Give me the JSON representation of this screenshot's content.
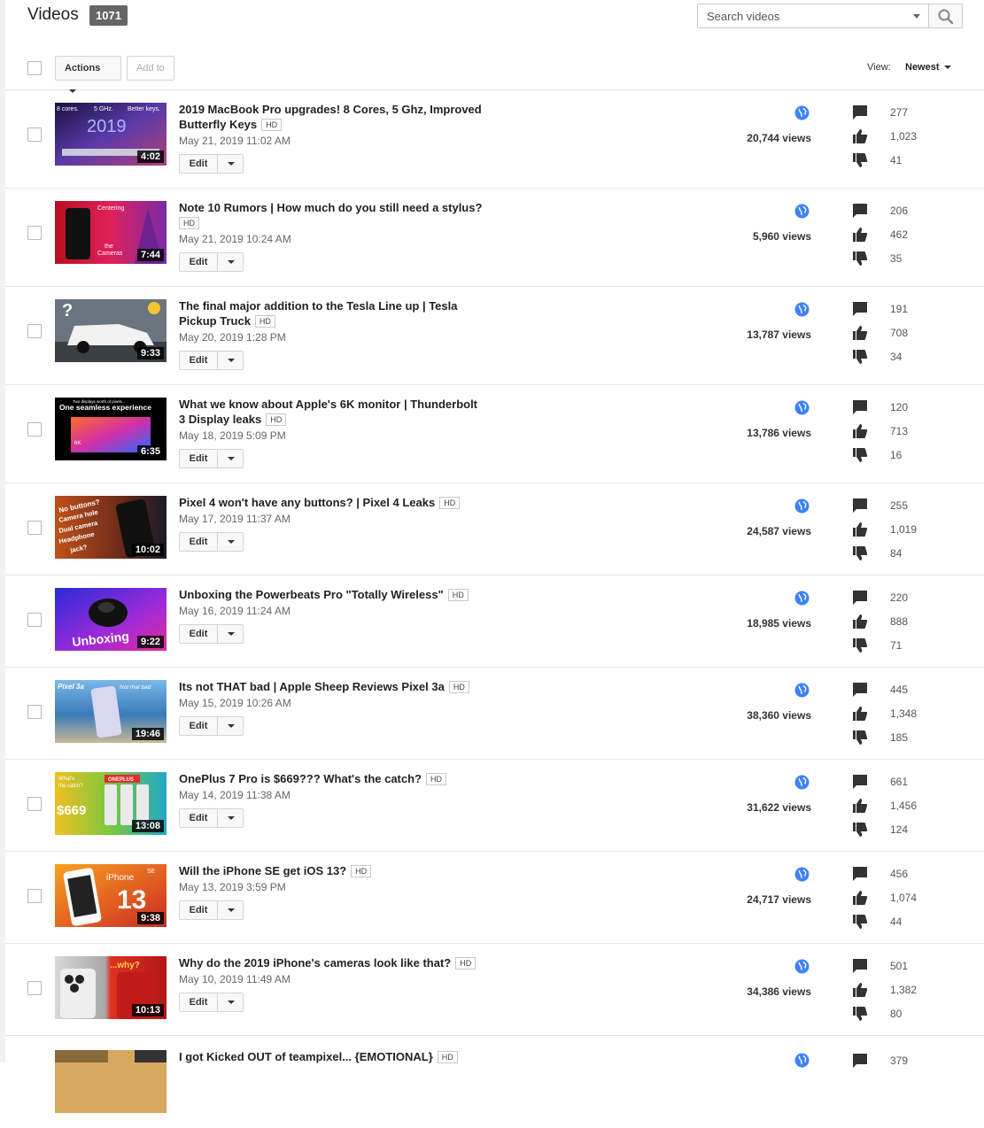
{
  "header": {
    "title": "Videos",
    "count": "1071",
    "search_placeholder": "Search videos"
  },
  "toolbar": {
    "actions_label": "Actions",
    "add_to_label": "Add to",
    "view_label": "View:",
    "sort_value": "Newest"
  },
  "icons": {
    "search": "search-icon",
    "globe": "globe-icon",
    "comments": "comment-icon",
    "likes": "thumbs-up-icon",
    "dislikes": "thumbs-down-icon"
  },
  "colors": {
    "globe": "#3e82f7",
    "badge": "#666666",
    "stat_icon": "#333333"
  },
  "videos": [
    {
      "title": "2019 MacBook Pro upgrades! 8 Cores, 5 Ghz, Improved Butterfly Keys",
      "hd": "HD",
      "date": "May 21, 2019 11:02 AM",
      "duration": "4:02",
      "views": "20,744 views",
      "comments": "277",
      "likes": "1,023",
      "dislikes": "41",
      "edit_label": "Edit",
      "thumb_text": [
        "8 cores.",
        "5 GHz.",
        "Better keys.",
        "2019"
      ]
    },
    {
      "title": "Note 10 Rumors | How much do you still need a stylus?",
      "hd": "HD",
      "date": "May 21, 2019 10:24 AM",
      "duration": "7:44",
      "views": "5,960 views",
      "comments": "206",
      "likes": "462",
      "dislikes": "35",
      "edit_label": "Edit",
      "thumb_text": [
        "Centering",
        "the",
        "Cameras"
      ]
    },
    {
      "title": "The final major addition to the Tesla Line up | Tesla Pickup Truck",
      "hd": "HD",
      "date": "May 20, 2019 1:28 PM",
      "duration": "9:33",
      "views": "13,787 views",
      "comments": "191",
      "likes": "708",
      "dislikes": "34",
      "edit_label": "Edit",
      "thumb_text": [
        "?"
      ]
    },
    {
      "title": "What we know about Apple's 6K monitor | Thunderbolt 3 Display leaks",
      "hd": "HD",
      "date": "May 18, 2019 5:09 PM",
      "duration": "6:35",
      "views": "13,786 views",
      "comments": "120",
      "likes": "713",
      "dislikes": "16",
      "edit_label": "Edit",
      "thumb_text": [
        "Two displays worth of pixels...",
        "One seamless experience",
        "6K"
      ]
    },
    {
      "title": "Pixel 4 won't have any buttons? | Pixel 4 Leaks",
      "hd": "HD",
      "date": "May 17, 2019 11:37 AM",
      "duration": "10:02",
      "views": "24,587 views",
      "comments": "255",
      "likes": "1,019",
      "dislikes": "84",
      "edit_label": "Edit",
      "thumb_text": [
        "No buttons?",
        "Camera hole",
        "Dual camera",
        "Headphone",
        "jack?"
      ]
    },
    {
      "title": "Unboxing the Powerbeats Pro \"Totally Wireless\"",
      "hd": "HD",
      "date": "May 16, 2019 11:24 AM",
      "duration": "9:22",
      "views": "18,985 views",
      "comments": "220",
      "likes": "888",
      "dislikes": "71",
      "edit_label": "Edit",
      "thumb_text": [
        "Unboxing"
      ]
    },
    {
      "title": "Its not THAT bad | Apple Sheep Reviews Pixel 3a",
      "hd": "HD",
      "date": "May 15, 2019 10:26 AM",
      "duration": "19:46",
      "views": "38,360 views",
      "comments": "445",
      "likes": "1,348",
      "dislikes": "185",
      "edit_label": "Edit",
      "thumb_text": [
        "Pixel 3a",
        "Not that bad"
      ]
    },
    {
      "title": "OnePlus 7 Pro is $669??? What's the catch?",
      "hd": "HD",
      "date": "May 14, 2019 11:38 AM",
      "duration": "13:08",
      "views": "31,622 views",
      "comments": "661",
      "likes": "1,456",
      "dislikes": "124",
      "edit_label": "Edit",
      "thumb_text": [
        "What's",
        "the catch?",
        "ONEPLUS",
        "$669"
      ]
    },
    {
      "title": "Will the iPhone SE get iOS 13?",
      "hd": "HD",
      "date": "May 13, 2019 3:59 PM",
      "duration": "9:38",
      "views": "24,717 views",
      "comments": "456",
      "likes": "1,074",
      "dislikes": "44",
      "edit_label": "Edit",
      "thumb_text": [
        "iPhone",
        "SE",
        "13"
      ]
    },
    {
      "title": "Why do the 2019 iPhone's cameras look like that?",
      "hd": "HD",
      "date": "May 10, 2019 11:49 AM",
      "duration": "10:13",
      "views": "34,386 views",
      "comments": "501",
      "likes": "1,382",
      "dislikes": "80",
      "edit_label": "Edit",
      "thumb_text": [
        "...why?"
      ]
    },
    {
      "title": "I got Kicked OUT of teampixel... {EMOTIONAL}",
      "hd": "HD",
      "date": "",
      "duration": "",
      "views": "",
      "comments": "379",
      "likes": "",
      "dislikes": "",
      "edit_label": "",
      "thumb_text": []
    }
  ]
}
